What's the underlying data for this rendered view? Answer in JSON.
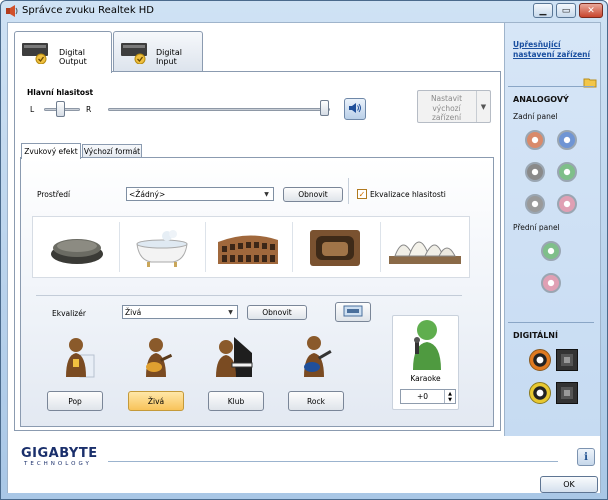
{
  "window": {
    "title": "Správce zvuku Realtek HD",
    "controls": [
      "minimize",
      "maximize",
      "close"
    ]
  },
  "top_tabs": [
    {
      "label": "Digital Output",
      "active": true
    },
    {
      "label": "Digital Input",
      "active": false
    }
  ],
  "master_volume": {
    "label": "Hlavní hlasitost",
    "left_label": "L",
    "right_label": "R",
    "balance": 0.5,
    "volume": 1.0,
    "set_default_label": "Nastavit\nvýchozí\nzařízení"
  },
  "inner_tabs": [
    {
      "label": "Zvukový efekt",
      "active": true
    },
    {
      "label": "Výchozí formát",
      "active": false
    }
  ],
  "environment": {
    "label": "Prostředí",
    "selected": "<Žádný>",
    "reset_label": "Obnovit",
    "loudness_label": "Ekvalizace hlasitosti",
    "loudness_checked": true,
    "presets": [
      "stone-icon",
      "bathtub-icon",
      "colosseum-icon",
      "cave-icon",
      "opera-house-icon"
    ]
  },
  "equalizer": {
    "label": "Ekvalizér",
    "selected": "Živá",
    "reset_label": "Obnovit",
    "presets": [
      {
        "label": "Pop",
        "icon": "pop-singer-icon",
        "selected": false
      },
      {
        "label": "Živá",
        "icon": "guitarist-icon",
        "selected": true
      },
      {
        "label": "Klub",
        "icon": "pianist-icon",
        "selected": false
      },
      {
        "label": "Rock",
        "icon": "rock-guitarist-icon",
        "selected": false
      }
    ]
  },
  "karaoke": {
    "label": "Karaoke",
    "value": "+0"
  },
  "right_panel": {
    "advanced_link": "Upřesňující nastavení zařízení",
    "analog_heading": "ANALOGOVÝ",
    "rear_panel_label": "Zadní panel",
    "front_panel_label": "Přední panel",
    "digital_heading": "DIGITÁLNÍ",
    "rear_jacks": [
      "#d98a6a",
      "#6f95d4",
      "#8a8a8a",
      "#7fbf8a",
      "#9a9a9a",
      "#e0a0b4"
    ],
    "front_jacks": [
      "#7fbf8a",
      "#e0a0b4"
    ]
  },
  "footer": {
    "brand": "GIGABYTE",
    "brand_sub": "TECHNOLOGY",
    "ok_label": "OK",
    "info_label": "i"
  }
}
